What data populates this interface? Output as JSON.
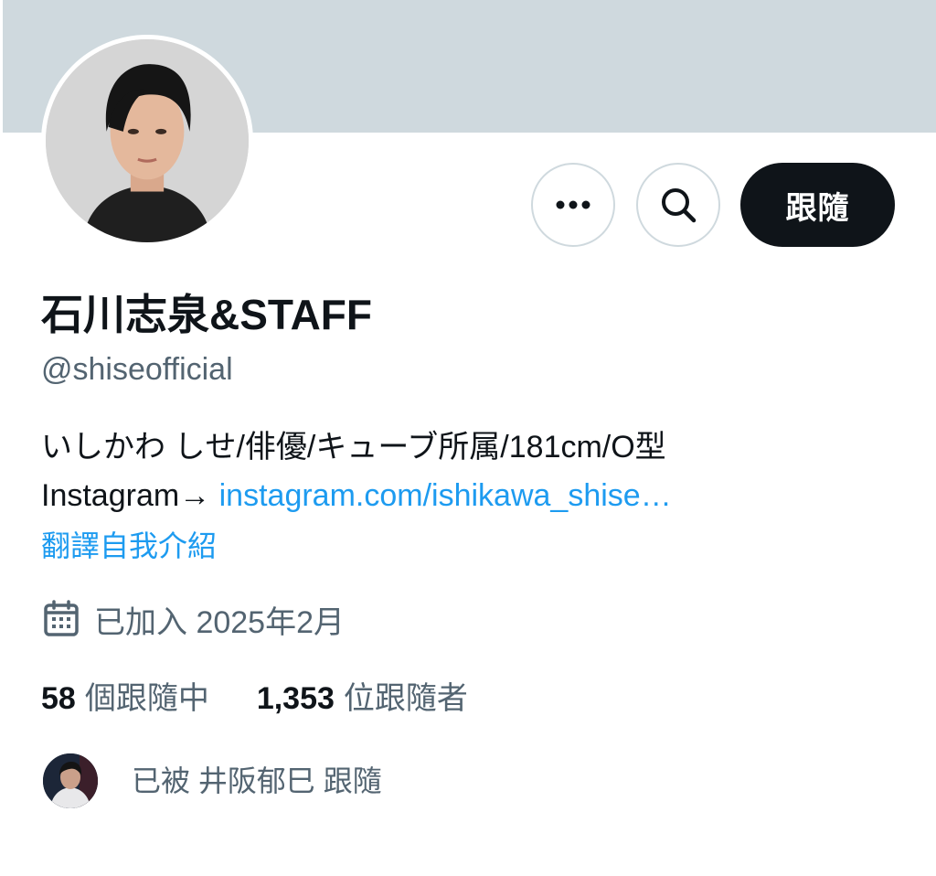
{
  "profile": {
    "display_name": "石川志泉&STAFF",
    "handle": "@shiseofficial",
    "bio_line1": "いしかわ しせ/俳優/キューブ所属/181cm/O型",
    "bio_prefix": "Instagram→ ",
    "bio_link": "instagram.com/ishikawa_shise…",
    "translate": "翻譯自我介紹",
    "joined": "已加入 2025年2月"
  },
  "actions": {
    "follow_label": "跟隨",
    "more_icon": "more-icon",
    "search_icon": "search-icon"
  },
  "stats": {
    "following_count": "58",
    "following_label": "個跟隨中",
    "followers_count": "1,353",
    "followers_label": "位跟隨者"
  },
  "followed_by": {
    "text": "已被 井阪郁巳 跟隨"
  },
  "colors": {
    "banner": "#cfd9de",
    "link": "#1d9bf0",
    "secondary_text": "#536471",
    "follow_button": "#0f1419"
  }
}
